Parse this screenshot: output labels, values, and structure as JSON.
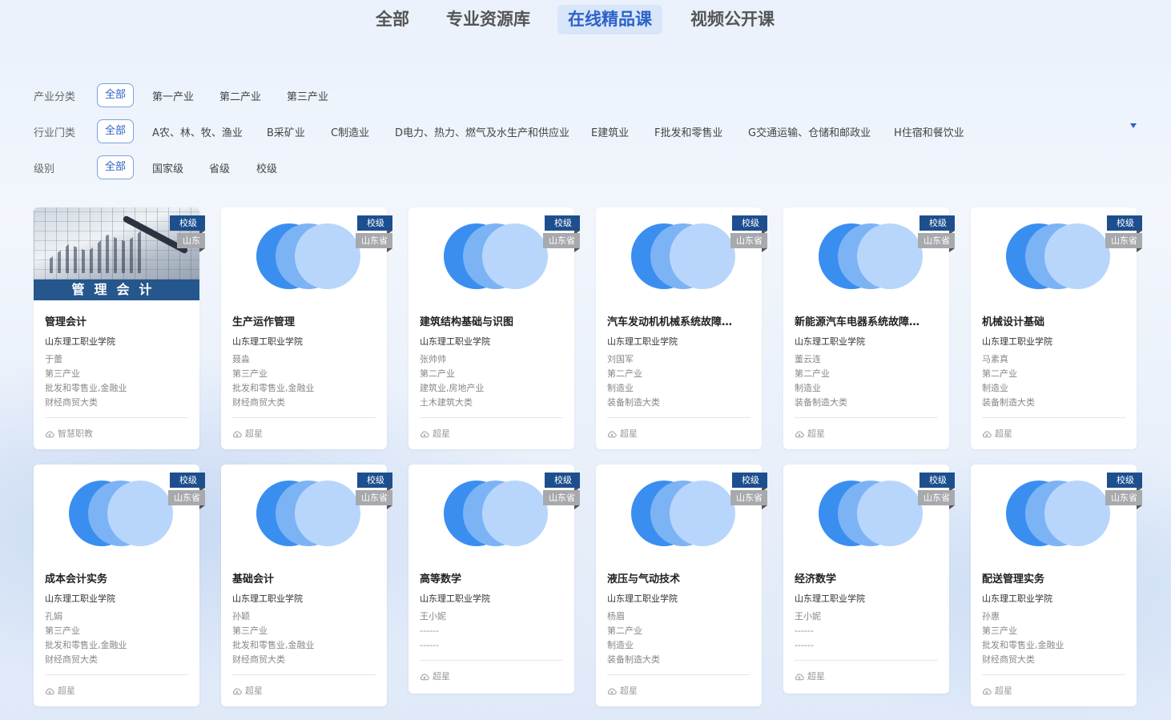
{
  "tabs": [
    "全部",
    "专业资源库",
    "在线精品课",
    "视频公开课"
  ],
  "active_tab": "在线精品课",
  "filters": {
    "industry_class": {
      "label": "产业分类",
      "options": [
        "全部",
        "第一产业",
        "第二产业",
        "第三产业"
      ]
    },
    "industry_sector": {
      "label": "行业门类",
      "options": [
        "全部",
        "A农、林、牧、渔业",
        "B采矿业",
        "C制造业",
        "D电力、热力、燃气及水生产和供应业",
        "E建筑业",
        "F批发和零售业",
        "G交通运输、仓储和邮政业",
        "H住宿和餐饮业"
      ]
    },
    "level": {
      "label": "级别",
      "options": [
        "全部",
        "国家级",
        "省级",
        "校级"
      ]
    }
  },
  "icons": {
    "expand": "triangle-down-icon",
    "platform": "cloud-icon"
  },
  "colors": {
    "accent": "#2d62c8",
    "badge_level": "#1d4f8f",
    "badge_region": "#a7a9ad"
  },
  "courses": [
    {
      "title": "管理会计",
      "school": "山东理工职业学院",
      "teacher": "于蕾",
      "industry": "第三产业",
      "sector": "批发和零售业,金融业",
      "category": "财经商贸大类",
      "platform": "智慧职教",
      "level": "校级",
      "region": "山东",
      "cover": "photo",
      "cover_text": "管理会计"
    },
    {
      "title": "生产运作管理",
      "school": "山东理工职业学院",
      "teacher": "聂淼",
      "industry": "第三产业",
      "sector": "批发和零售业,金融业",
      "category": "财经商贸大类",
      "platform": "超星",
      "level": "校级",
      "region": "山东省"
    },
    {
      "title": "建筑结构基础与识图",
      "school": "山东理工职业学院",
      "teacher": "张帅帅",
      "industry": "第二产业",
      "sector": "建筑业,房地产业",
      "category": "土木建筑大类",
      "platform": "超星",
      "level": "校级",
      "region": "山东省"
    },
    {
      "title": "汽车发动机机械系统故障…",
      "school": "山东理工职业学院",
      "teacher": "刘国军",
      "industry": "第二产业",
      "sector": "制造业",
      "category": "装备制造大类",
      "platform": "超星",
      "level": "校级",
      "region": "山东省"
    },
    {
      "title": "新能源汽车电器系统故障…",
      "school": "山东理工职业学院",
      "teacher": "董云连",
      "industry": "第二产业",
      "sector": "制造业",
      "category": "装备制造大类",
      "platform": "超星",
      "level": "校级",
      "region": "山东省"
    },
    {
      "title": "机械设计基础",
      "school": "山东理工职业学院",
      "teacher": "马素真",
      "industry": "第二产业",
      "sector": "制造业",
      "category": "装备制造大类",
      "platform": "超星",
      "level": "校级",
      "region": "山东省"
    },
    {
      "title": "成本会计实务",
      "school": "山东理工职业学院",
      "teacher": "孔娟",
      "industry": "第三产业",
      "sector": "批发和零售业,金融业",
      "category": "财经商贸大类",
      "platform": "超星",
      "level": "校级",
      "region": "山东省"
    },
    {
      "title": "基础会计",
      "school": "山东理工职业学院",
      "teacher": "孙颖",
      "industry": "第三产业",
      "sector": "批发和零售业,金融业",
      "category": "财经商贸大类",
      "platform": "超星",
      "level": "校级",
      "region": "山东省"
    },
    {
      "title": "高等数学",
      "school": "山东理工职业学院",
      "teacher": "王小妮",
      "industry": "------",
      "sector": "------",
      "category": "",
      "platform": "超星",
      "level": "校级",
      "region": "山东省"
    },
    {
      "title": "液压与气动技术",
      "school": "山东理工职业学院",
      "teacher": "杨眉",
      "industry": "第二产业",
      "sector": "制造业",
      "category": "装备制造大类",
      "platform": "超星",
      "level": "校级",
      "region": "山东省"
    },
    {
      "title": "经济数学",
      "school": "山东理工职业学院",
      "teacher": "王小妮",
      "industry": "------",
      "sector": "------",
      "category": "",
      "platform": "超星",
      "level": "校级",
      "region": "山东省"
    },
    {
      "title": "配送管理实务",
      "school": "山东理工职业学院",
      "teacher": "孙惠",
      "industry": "第三产业",
      "sector": "批发和零售业,金融业",
      "category": "财经商贸大类",
      "platform": "超星",
      "level": "校级",
      "region": "山东省"
    }
  ]
}
